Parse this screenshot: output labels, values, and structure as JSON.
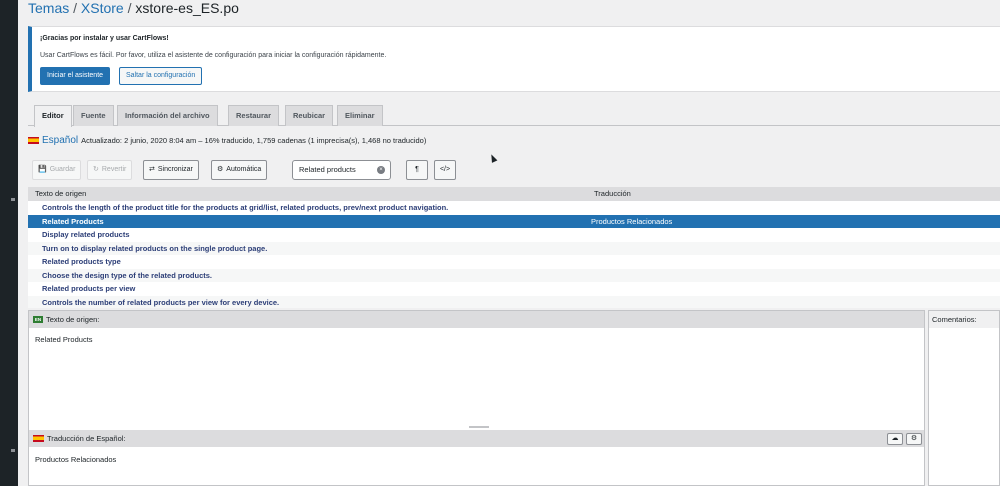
{
  "breadcrumb": {
    "item1": "Temas",
    "item2": "XStore",
    "current": "xstore-es_ES.po",
    "separator": "/"
  },
  "notice": {
    "title": "¡Gracias por instalar y usar CartFlows!",
    "text": "Usar CartFlows es fácil. Por favor, utiliza el asistente de configuración para iniciar la configuración rápidamente.",
    "primary_button": "Iniciar el asistente",
    "secondary_button": "Saltar la configuración"
  },
  "tabs": [
    "Editor",
    "Fuente",
    "Información del archivo",
    "Restaurar",
    "Reubicar",
    "Eliminar"
  ],
  "active_tab": "Editor",
  "locale": {
    "name": "Español",
    "meta": "Actualizado: 2 junio, 2020 8:04 am – 16% traducido, 1,759 cadenas (1 imprecisa(s), 1,468 no traducido)"
  },
  "toolbar": {
    "save": "Guardar",
    "revert": "Revertir",
    "sync": "Sincronizar",
    "auto": "Automática",
    "search_value": "Related products",
    "pilcrow": "¶",
    "code": "</>"
  },
  "grid": {
    "col_source": "Texto de origen",
    "col_translation": "Traducción",
    "rows": [
      {
        "source": "Controls the length of the product title for the products at grid/list, related products, prev/next product navigation.",
        "translation": ""
      },
      {
        "source": "Related Products",
        "translation": "Productos Relacionados",
        "selected": true
      },
      {
        "source": "Display related products",
        "translation": ""
      },
      {
        "source": "Turn on to display related products on the single product page.",
        "translation": ""
      },
      {
        "source": "Related products type",
        "translation": ""
      },
      {
        "source": "Choose the design type of the related products.",
        "translation": ""
      },
      {
        "source": "Related products per view",
        "translation": ""
      },
      {
        "source": "Controls the number of related products per view for every device.",
        "translation": ""
      }
    ]
  },
  "editor": {
    "source_badge": "EN",
    "source_label": "Texto de origen:",
    "source_text": "Related Products",
    "translation_label": "Traducción de Español:",
    "translation_text": "Productos Relacionados"
  },
  "comments": {
    "label": "Comentarios:"
  },
  "colors": {
    "accent": "#2271b1",
    "selected_row": "#2271b1",
    "row_text": "#2c3e77"
  }
}
